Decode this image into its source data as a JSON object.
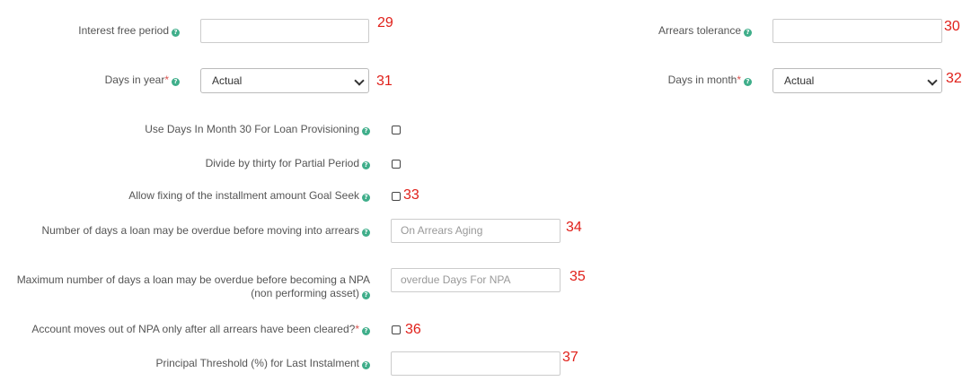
{
  "fields": {
    "interest_free_period": {
      "label": "Interest free period",
      "value": "",
      "marker": "29"
    },
    "arrears_tolerance": {
      "label": "Arrears tolerance",
      "value": "",
      "marker": "30"
    },
    "days_in_year": {
      "label": "Days in year",
      "required": "*",
      "value": "Actual",
      "marker": "31"
    },
    "days_in_month": {
      "label": "Days in month",
      "required": "*",
      "value": "Actual",
      "marker": "32"
    },
    "use_days_30": {
      "label": "Use Days In Month 30 For Loan Provisioning",
      "checked": false
    },
    "divide_by_thirty": {
      "label": "Divide by thirty for Partial Period",
      "checked": false
    },
    "goal_seek": {
      "label": "Allow fixing of the installment amount Goal Seek",
      "checked": false,
      "marker": "33"
    },
    "overdue_arrears": {
      "label": "Number of days a loan may be overdue before moving into arrears",
      "placeholder": "On Arrears Aging",
      "marker": "34"
    },
    "overdue_npa": {
      "label": "Maximum number of days a loan may be overdue before becoming a NPA (non performing asset)",
      "placeholder": "overdue Days For NPA",
      "marker": "35"
    },
    "npa_cleared": {
      "label": "Account moves out of NPA only after all arrears have been cleared?",
      "required": "*",
      "checked": false,
      "marker": "36"
    },
    "principal_threshold": {
      "label": "Principal Threshold (%) for Last Instalment",
      "value": "",
      "marker": "37"
    }
  },
  "help_icon_glyph": "?",
  "colors": {
    "help_icon": "#3fae8a",
    "marker": "#e0201a",
    "required": "#d9534f"
  }
}
